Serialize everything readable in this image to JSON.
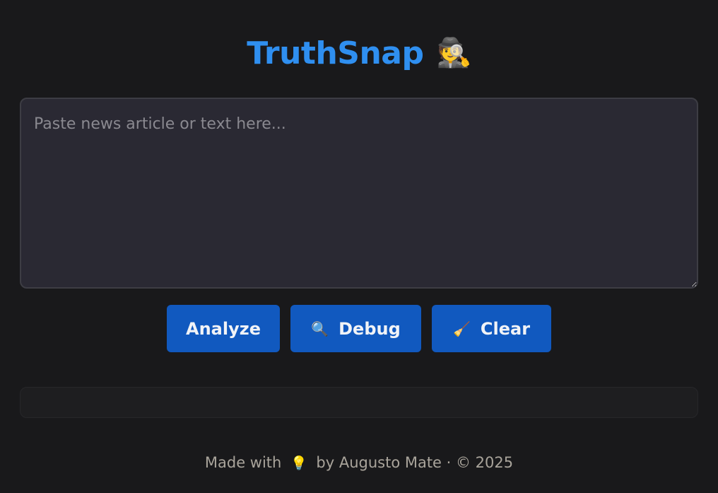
{
  "app": {
    "title": "TruthSnap",
    "title_icon": "detective-emoji"
  },
  "input": {
    "placeholder": "Paste news article or text here...",
    "value": ""
  },
  "actions": {
    "analyze_label": "Analyze",
    "debug_label": "Debug",
    "debug_icon": "magnifying-glass-icon",
    "clear_label": "Clear",
    "clear_icon": "broom-icon"
  },
  "result": {
    "text": ""
  },
  "footer": {
    "made_with": "Made with",
    "made_with_icon": "lightbulb-icon",
    "by_text": "by Augusto Mate · © 2025"
  },
  "colors": {
    "background": "#19191b",
    "title": "#2f8ff0",
    "button": "#1159bf",
    "textarea_bg": "#2a2933"
  }
}
